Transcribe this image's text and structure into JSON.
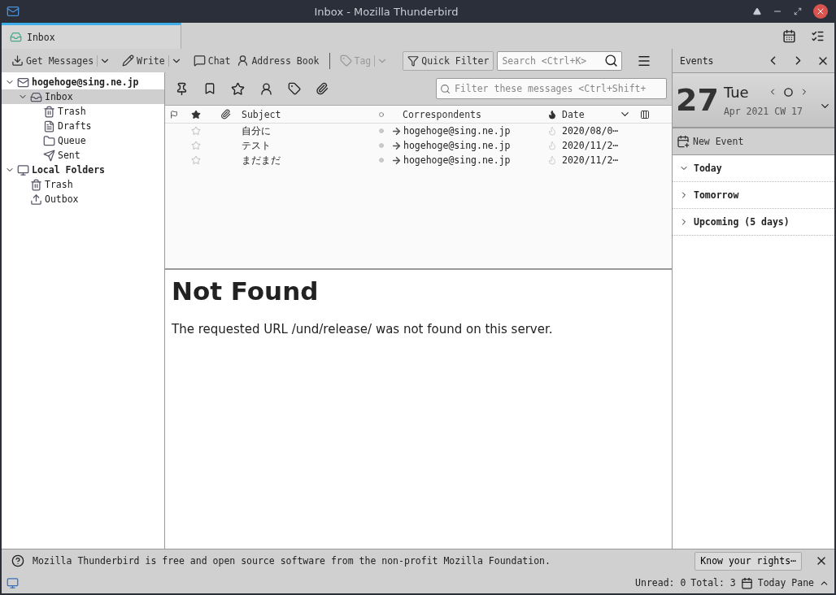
{
  "window": {
    "title": "Inbox - Mozilla Thunderbird"
  },
  "tabs": [
    {
      "label": "Inbox",
      "selected": true
    }
  ],
  "toolbar": {
    "buttons": [
      {
        "label": "Get Messages",
        "kind": "get",
        "split": true,
        "disabled": false
      },
      {
        "label": "Write",
        "kind": "write",
        "split": true,
        "disabled": false
      },
      {
        "label": "Chat",
        "kind": "chat",
        "split": false,
        "disabled": false
      },
      {
        "label": "Address Book",
        "kind": "contacts",
        "split": false,
        "disabled": false
      },
      {
        "label": "Tag",
        "kind": "tag",
        "split": true,
        "disabled": true
      }
    ],
    "quick_filter": {
      "label": "Quick Filter",
      "on": false
    },
    "search": {
      "placeholder": "Search <Ctrl+K>"
    }
  },
  "folders": [
    {
      "label": "hogehoge@sing.ne.jp",
      "kind": "account",
      "expanded": true,
      "selected": false,
      "children": [
        {
          "label": "Inbox",
          "kind": "inbox",
          "expanded": true,
          "selected": true,
          "children": [
            {
              "label": "Trash",
              "kind": "trash",
              "selected": false
            },
            {
              "label": "Drafts",
              "kind": "drafts",
              "selected": false
            },
            {
              "label": "Queue",
              "kind": "queue",
              "selected": false
            },
            {
              "label": "Sent",
              "kind": "sent",
              "selected": false
            }
          ]
        }
      ]
    },
    {
      "label": "Local Folders",
      "kind": "local",
      "expanded": true,
      "selected": false,
      "children": [
        {
          "label": "Trash",
          "kind": "trash",
          "selected": false
        },
        {
          "label": "Outbox",
          "kind": "outbox",
          "selected": false
        }
      ]
    }
  ],
  "filter_bar": {
    "placeholder": "Filter these messages <Ctrl+Shift+"
  },
  "columns": {
    "subject": "Subject",
    "correspondents": "Correspondents",
    "date": "Date"
  },
  "messages": [
    {
      "subject": "自分に",
      "correspondent": "hogehoge@sing.ne.jp",
      "date": "2020/08/0⋯",
      "starred": false,
      "unread": false
    },
    {
      "subject": "テスト",
      "correspondent": "hogehoge@sing.ne.jp",
      "date": "2020/11/2⋯",
      "starred": false,
      "unread": false
    },
    {
      "subject": "まだまだ",
      "correspondent": "hogehoge@sing.ne.jp",
      "date": "2020/11/2⋯",
      "starred": false,
      "unread": false
    }
  ],
  "preview": {
    "heading": "Not Found",
    "body": "The requested URL /und/release/ was not found on this server."
  },
  "events": {
    "title": "Events",
    "day": "27",
    "weekday": "Tue",
    "month_line": "Apr 2021 CW 17",
    "new_event": "New Event",
    "sections": [
      {
        "label": "Today",
        "expanded": true
      },
      {
        "label": "Tomorrow",
        "expanded": false
      },
      {
        "label": "Upcoming (5 days)",
        "expanded": false
      }
    ]
  },
  "notification": {
    "text": "Mozilla Thunderbird is free and open source software from the non-profit Mozilla Foundation.",
    "button": "Know your rights⋯"
  },
  "status": {
    "unread": "Unread: 0",
    "total": "Total: 3",
    "today_pane": "Today Pane"
  }
}
